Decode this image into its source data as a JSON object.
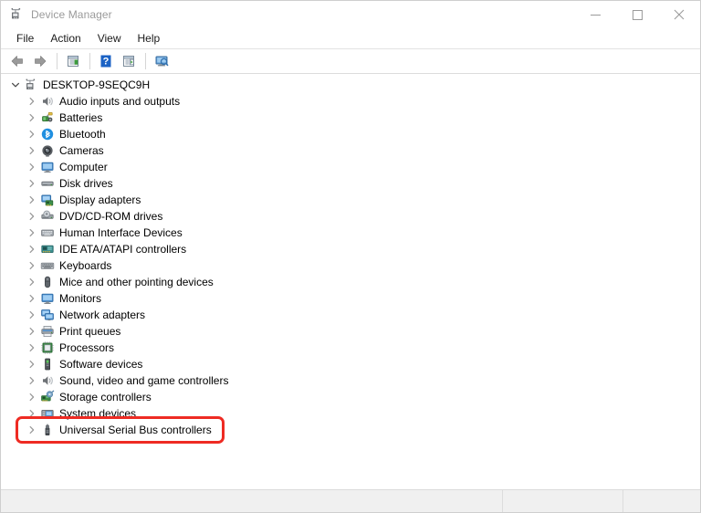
{
  "window": {
    "title": "Device Manager",
    "icon": "device-manager-icon",
    "controls": {
      "minimize": "Minimize",
      "maximize": "Maximize",
      "close": "Close"
    }
  },
  "menubar": {
    "items": [
      {
        "label": "File"
      },
      {
        "label": "Action"
      },
      {
        "label": "View"
      },
      {
        "label": "Help"
      }
    ]
  },
  "toolbar": {
    "buttons": [
      {
        "name": "back-button",
        "icon": "back-arrow-icon",
        "label": "Back"
      },
      {
        "name": "forward-button",
        "icon": "forward-arrow-icon",
        "label": "Forward"
      },
      {
        "name": "separator-1",
        "icon": "separator",
        "label": ""
      },
      {
        "name": "properties-button",
        "icon": "properties-icon",
        "label": "Properties"
      },
      {
        "name": "separator-2",
        "icon": "separator",
        "label": ""
      },
      {
        "name": "help-button",
        "icon": "help-question-icon",
        "label": "Help"
      },
      {
        "name": "update-driver-button",
        "icon": "update-driver-icon",
        "label": "Update Driver Software"
      },
      {
        "name": "separator-3",
        "icon": "separator",
        "label": ""
      },
      {
        "name": "scan-hardware-button",
        "icon": "scan-hardware-icon",
        "label": "Scan for hardware changes"
      }
    ]
  },
  "tree": {
    "root": {
      "label": "DESKTOP-9SEQC9H",
      "icon": "computer-root-icon",
      "expanded": true
    },
    "items": [
      {
        "label": "Audio inputs and outputs",
        "icon": "speaker-icon"
      },
      {
        "label": "Batteries",
        "icon": "battery-icon"
      },
      {
        "label": "Bluetooth",
        "icon": "bluetooth-icon"
      },
      {
        "label": "Cameras",
        "icon": "camera-icon"
      },
      {
        "label": "Computer",
        "icon": "monitor-icon"
      },
      {
        "label": "Disk drives",
        "icon": "disk-drive-icon"
      },
      {
        "label": "Display adapters",
        "icon": "display-adapter-icon"
      },
      {
        "label": "DVD/CD-ROM drives",
        "icon": "dvd-drive-icon"
      },
      {
        "label": "Human Interface Devices",
        "icon": "hid-icon"
      },
      {
        "label": "IDE ATA/ATAPI controllers",
        "icon": "ide-controller-icon"
      },
      {
        "label": "Keyboards",
        "icon": "keyboard-icon"
      },
      {
        "label": "Mice and other pointing devices",
        "icon": "mouse-icon"
      },
      {
        "label": "Monitors",
        "icon": "monitor-icon"
      },
      {
        "label": "Network adapters",
        "icon": "network-adapter-icon"
      },
      {
        "label": "Print queues",
        "icon": "printer-icon"
      },
      {
        "label": "Processors",
        "icon": "processor-icon"
      },
      {
        "label": "Software devices",
        "icon": "software-device-icon"
      },
      {
        "label": "Sound, video and game controllers",
        "icon": "speaker-icon"
      },
      {
        "label": "Storage controllers",
        "icon": "storage-controller-icon"
      },
      {
        "label": "System devices",
        "icon": "system-device-icon"
      },
      {
        "label": "Universal Serial Bus controllers",
        "icon": "usb-icon",
        "highlighted": true
      }
    ]
  },
  "highlight": {
    "color": "#ee2b23",
    "target": "Universal Serial Bus controllers"
  },
  "statusbar": {
    "panes": [
      "",
      "",
      ""
    ]
  }
}
